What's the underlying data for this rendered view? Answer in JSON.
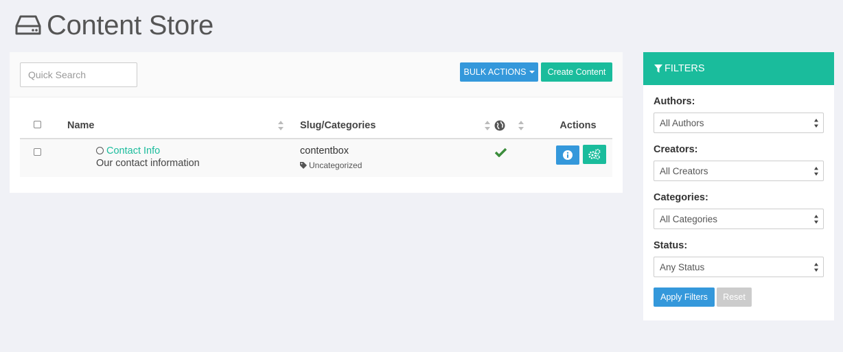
{
  "page": {
    "title": "Content Store"
  },
  "toolbar": {
    "search_placeholder": "Quick Search",
    "bulk_actions_label": "BULK ACTIONS",
    "create_label": "Create Content"
  },
  "table": {
    "headers": {
      "name": "Name",
      "slug": "Slug/Categories",
      "actions": "Actions"
    },
    "rows": [
      {
        "title": "Contact Info",
        "description": "Our contact information",
        "slug": "contentbox",
        "category": "Uncategorized",
        "published": true
      }
    ]
  },
  "filters": {
    "title": "FILTERS",
    "authors_label": "Authors:",
    "authors_value": "All Authors",
    "creators_label": "Creators:",
    "creators_value": "All Creators",
    "categories_label": "Categories:",
    "categories_value": "All Categories",
    "status_label": "Status:",
    "status_value": "Any Status",
    "apply_label": "Apply Filters",
    "reset_label": "Reset"
  },
  "colors": {
    "primary": "#3498db",
    "accent": "#1abc9c",
    "success": "#3c8d3c"
  },
  "icons": [
    "hdd-icon",
    "sort-icon",
    "globe-icon",
    "circle-icon",
    "tag-icon",
    "check-icon",
    "info-icon",
    "gears-icon",
    "filter-icon",
    "caret-down-icon"
  ]
}
